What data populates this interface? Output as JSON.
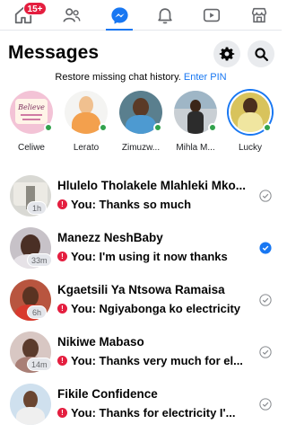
{
  "nav": {
    "items": [
      {
        "icon": "home-icon",
        "badge": "15+"
      },
      {
        "icon": "friends-icon"
      },
      {
        "icon": "messenger-icon"
      },
      {
        "icon": "bell-icon"
      },
      {
        "icon": "video-icon"
      },
      {
        "icon": "marketplace-icon"
      }
    ],
    "accent": "#1877f2",
    "badge_color": "#e41e3f"
  },
  "header": {
    "title": "Messages",
    "settings_icon": "gear-icon",
    "search_icon": "search-icon"
  },
  "restore": {
    "text": "Restore missing chat history.",
    "link": "Enter PIN"
  },
  "stories": [
    {
      "name": "Celiwe",
      "avatar_text": "Believe",
      "online": true
    },
    {
      "name": "Lerato",
      "online": true
    },
    {
      "name": "Zimuzw...",
      "online": true
    },
    {
      "name": "Mihla M...",
      "online": true
    },
    {
      "name": "Lucky",
      "online": true
    }
  ],
  "chats": [
    {
      "name": "Hlulelo Tholakele Mlahleki Mko...",
      "preview": "You: Thanks so much",
      "time": "1h",
      "status": "sent"
    },
    {
      "name": "Manezz NeshBaby",
      "preview": "You: I'm using it now thanks",
      "time": "33m",
      "status": "delivered"
    },
    {
      "name": "Kgaetsili Ya Ntsowa Ramaisa",
      "preview": "You: Ngiyabonga ko electricity",
      "time": "6h",
      "status": "sent"
    },
    {
      "name": "Nikiwe Mabaso",
      "preview": "You: Thanks very much for el...",
      "time": "14m",
      "status": "sent"
    },
    {
      "name": "Fikile Confidence",
      "preview": "You: Thanks for electricity I'...",
      "time": "",
      "status": "sent"
    }
  ]
}
